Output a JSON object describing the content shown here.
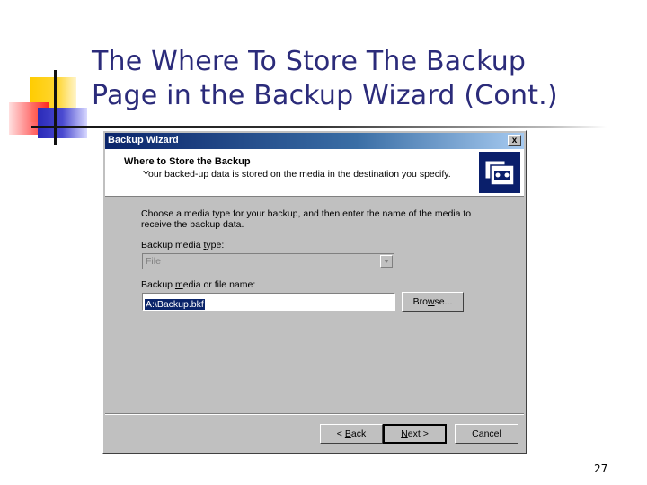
{
  "slide": {
    "title_line1": "The Where To Store The Backup",
    "title_line2": "Page in the Backup Wizard (Cont.)",
    "page_number": "27"
  },
  "dialog": {
    "title": "Backup Wizard",
    "close_label": "x",
    "header": {
      "title": "Where to Store the Backup",
      "subtitle": "Your backed-up data is stored on the media in the destination you specify.",
      "icon": "backup-media-icon"
    },
    "instructions": "Choose a media type for your backup, and then enter the name of the media to receive the backup data.",
    "media_type": {
      "label_pre": "Backup media ",
      "label_accel": "t",
      "label_post": "ype:",
      "value": "File"
    },
    "media_name": {
      "label_pre": "Backup ",
      "label_accel": "m",
      "label_post": "edia or file name:",
      "value": "A:\\Backup.bkf"
    },
    "browse": {
      "pre": "Bro",
      "accel": "w",
      "post": "se..."
    },
    "buttons": {
      "back": {
        "pre": "< ",
        "accel": "B",
        "post": "ack"
      },
      "next": {
        "pre": "",
        "accel": "N",
        "post": "ext >"
      },
      "cancel": "Cancel"
    }
  }
}
